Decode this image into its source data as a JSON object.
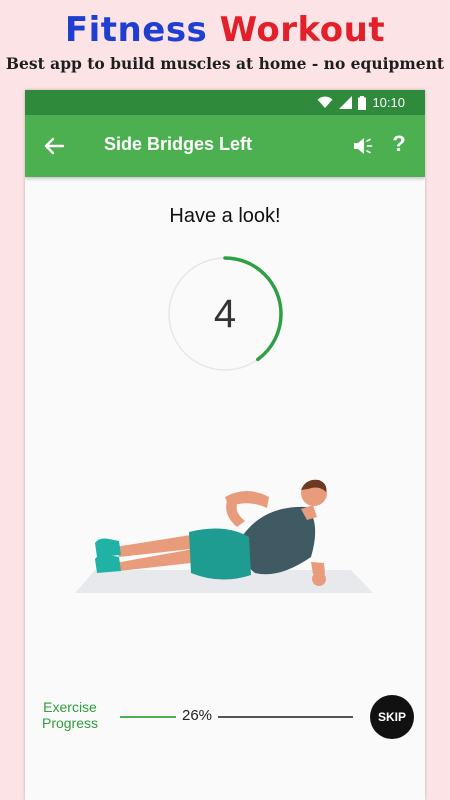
{
  "promo": {
    "title_part1": "Fitness",
    "title_part2": "Workout",
    "subtitle": "Best app to build muscles at home - no equipment"
  },
  "statusbar": {
    "time": "10:10",
    "icons": [
      "wifi-icon",
      "signal-icon",
      "battery-icon"
    ]
  },
  "appbar": {
    "title": "Side Bridges Left",
    "back_icon": "back-arrow-icon",
    "sound_icon": "speaker-icon",
    "help_label": "?"
  },
  "main": {
    "prompt": "Have a look!",
    "countdown": "4",
    "countdown_progress": 0.4
  },
  "progress": {
    "label": "Exercise\nProgress",
    "percent_label": "26%",
    "percent_value": 26,
    "skip_label": "SKIP"
  },
  "colors": {
    "background": "#fce4e6",
    "title_blue": "#1f3fd0",
    "title_red": "#e2202a",
    "status_green": "#2f8a3c",
    "appbar_green": "#4caf50",
    "progress_green": "#2e9e3d"
  }
}
